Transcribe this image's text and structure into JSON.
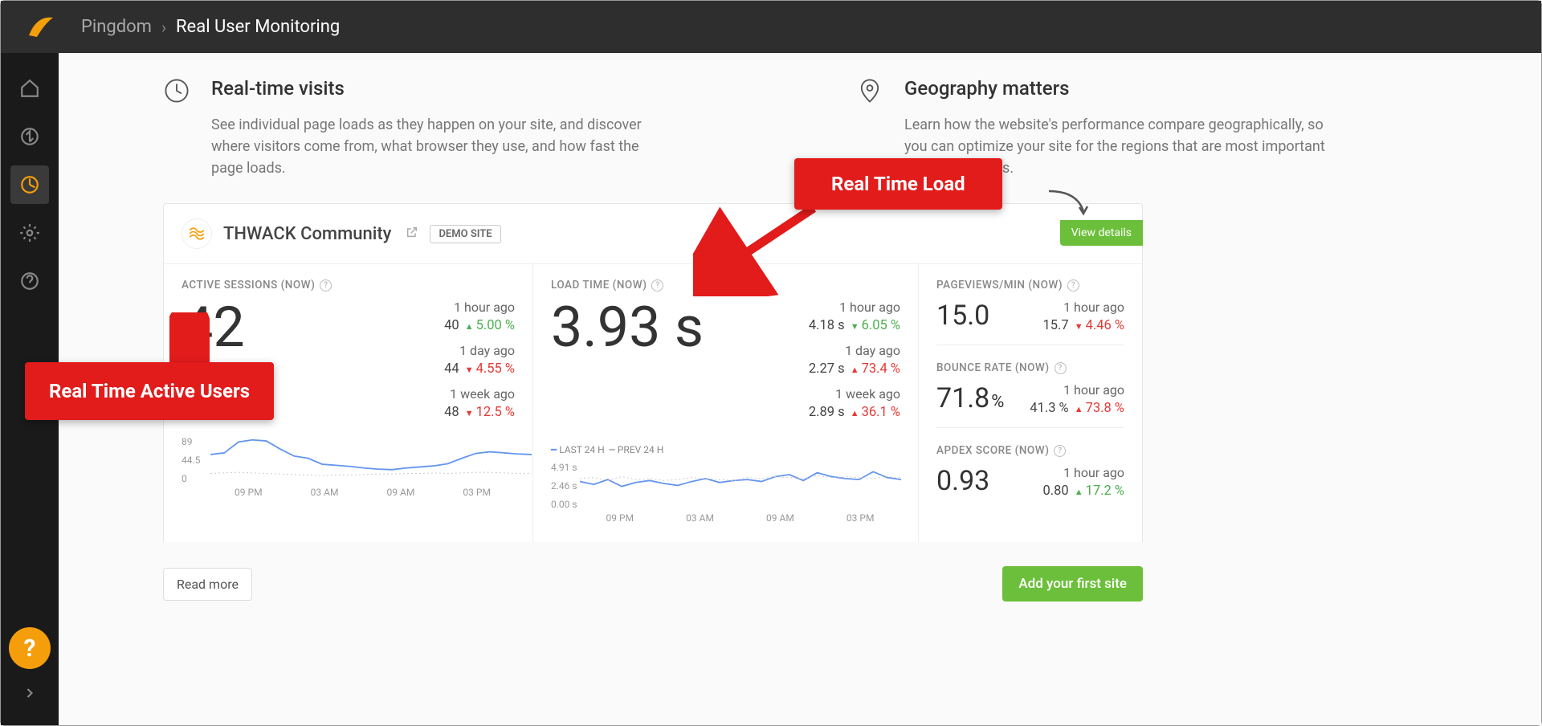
{
  "breadcrumb": {
    "a": "Pingdom",
    "b": "Real User Monitoring"
  },
  "intro1": {
    "title": "Real-time visits",
    "desc": "See individual page loads as they happen on your site, and discover where visitors come from, what browser they use, and how fast the page loads."
  },
  "intro2": {
    "title": "Geography matters",
    "desc": "Learn how the website's performance compare geographically, so you can optimize your site for the regions that are most important to your business."
  },
  "site": {
    "name": "THWACK Community",
    "badge": "DEMO SITE",
    "viewDetails": "View details"
  },
  "labels": {
    "active": "ACTIVE SESSIONS (NOW)",
    "load": "LOAD TIME (NOW)",
    "pv": "PAGEVIEWS/MIN (NOW)",
    "bounce": "BOUNCE RATE (NOW)",
    "apdex": "APDEX SCORE (NOW)",
    "hour": "1 hour ago",
    "day": "1 day ago",
    "week": "1 week ago",
    "legend": "LAST 24 H",
    "legend2": "PREV 24 H"
  },
  "active": {
    "big": "42",
    "hourVal": "40",
    "hourPct": "5.00 %",
    "hourDir": "up",
    "dayVal": "44",
    "dayPct": "4.55 %",
    "dayDir": "down",
    "weekVal": "48",
    "weekPct": "12.5 %",
    "weekDir": "down"
  },
  "load": {
    "big": "3.93 s",
    "hourVal": "4.18 s",
    "hourPct": "6.05 %",
    "hourDir": "up-good-down",
    "dayVal": "2.27 s",
    "dayPct": "73.4 %",
    "dayDir": "down-bad-up",
    "weekVal": "2.89 s",
    "weekPct": "36.1 %",
    "weekDir": "down-bad-up"
  },
  "pv": {
    "big": "15.0",
    "hourVal": "15.7",
    "hourPct": "4.46 %"
  },
  "bounce": {
    "big": "71.8",
    "unit": "%",
    "hourVal": "41.3 %",
    "hourPct": "73.8 %"
  },
  "apdex": {
    "big": "0.93",
    "hourVal": "0.80",
    "hourPct": "17.2 %"
  },
  "callouts": {
    "users": "Real Time Active Users",
    "load": "Real Time Load"
  },
  "buttons": {
    "readMore": "Read more",
    "addSite": "Add your first site"
  },
  "chart_data": [
    {
      "type": "line",
      "ylabel": "",
      "y_ticks": [
        0,
        44.5,
        89
      ],
      "x_ticks": [
        "09 PM",
        "03 AM",
        "09 AM",
        "03 PM"
      ],
      "series": [
        {
          "name": "LAST 24 H",
          "values": [
            55,
            58,
            78,
            82,
            80,
            65,
            52,
            48,
            37,
            35,
            33,
            30,
            28,
            27,
            30,
            32,
            34,
            38,
            48,
            57,
            60,
            58,
            56,
            55
          ]
        },
        {
          "name": "PREV 24 H",
          "values": [
            20,
            21,
            22,
            21,
            20,
            19,
            18,
            17,
            16,
            17,
            17,
            18,
            19,
            19,
            20,
            20,
            21,
            20,
            21,
            22,
            22,
            21,
            20,
            20
          ]
        }
      ]
    },
    {
      "type": "line",
      "ylabel": "",
      "y_ticks": [
        "0.00 s",
        "2.46 s",
        "4.91 s"
      ],
      "x_ticks": [
        "09 PM",
        "03 AM",
        "09 AM",
        "03 PM"
      ],
      "series": [
        {
          "name": "LAST 24 H",
          "values": [
            2.9,
            2.6,
            3.1,
            2.4,
            2.8,
            3.0,
            2.7,
            2.5,
            2.9,
            3.2,
            2.8,
            3.0,
            3.1,
            2.9,
            3.4,
            3.6,
            3.0,
            3.8,
            3.4,
            3.2,
            3.1,
            3.9,
            3.3,
            3.1
          ]
        },
        {
          "name": "PREV 24 H",
          "values": [
            3.2,
            3.3,
            3.0,
            3.4,
            3.1,
            3.2,
            3.0,
            3.1,
            3.3,
            3.2,
            3.1,
            3.0,
            3.3,
            3.2,
            3.4,
            3.3,
            3.2,
            3.5,
            3.3,
            3.4,
            3.3,
            3.2,
            3.4,
            3.3
          ]
        }
      ]
    }
  ]
}
